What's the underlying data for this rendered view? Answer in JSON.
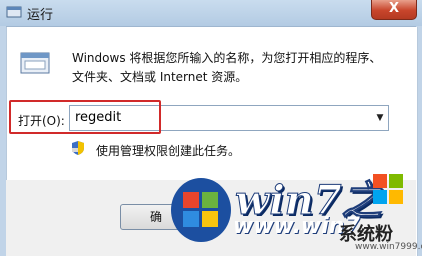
{
  "window": {
    "title": "运行",
    "close_label": "X"
  },
  "description": {
    "line1": "Windows 将根据您所输入的名称，为您打开相应的程序、",
    "line2": "文件夹、文档或 Internet 资源。"
  },
  "open_field": {
    "label": "打开(O):",
    "value": "regedit"
  },
  "admin_note": "使用管理权限创建此任务。",
  "buttons": {
    "ok": "确"
  },
  "watermark": {
    "logo_text": "win7之",
    "url_main": "www.win7",
    "brand": "系统粉",
    "url_small": "www.win7999.com"
  },
  "colors": {
    "highlight": "#d12a2a",
    "title_bar": "#c9dcee"
  }
}
